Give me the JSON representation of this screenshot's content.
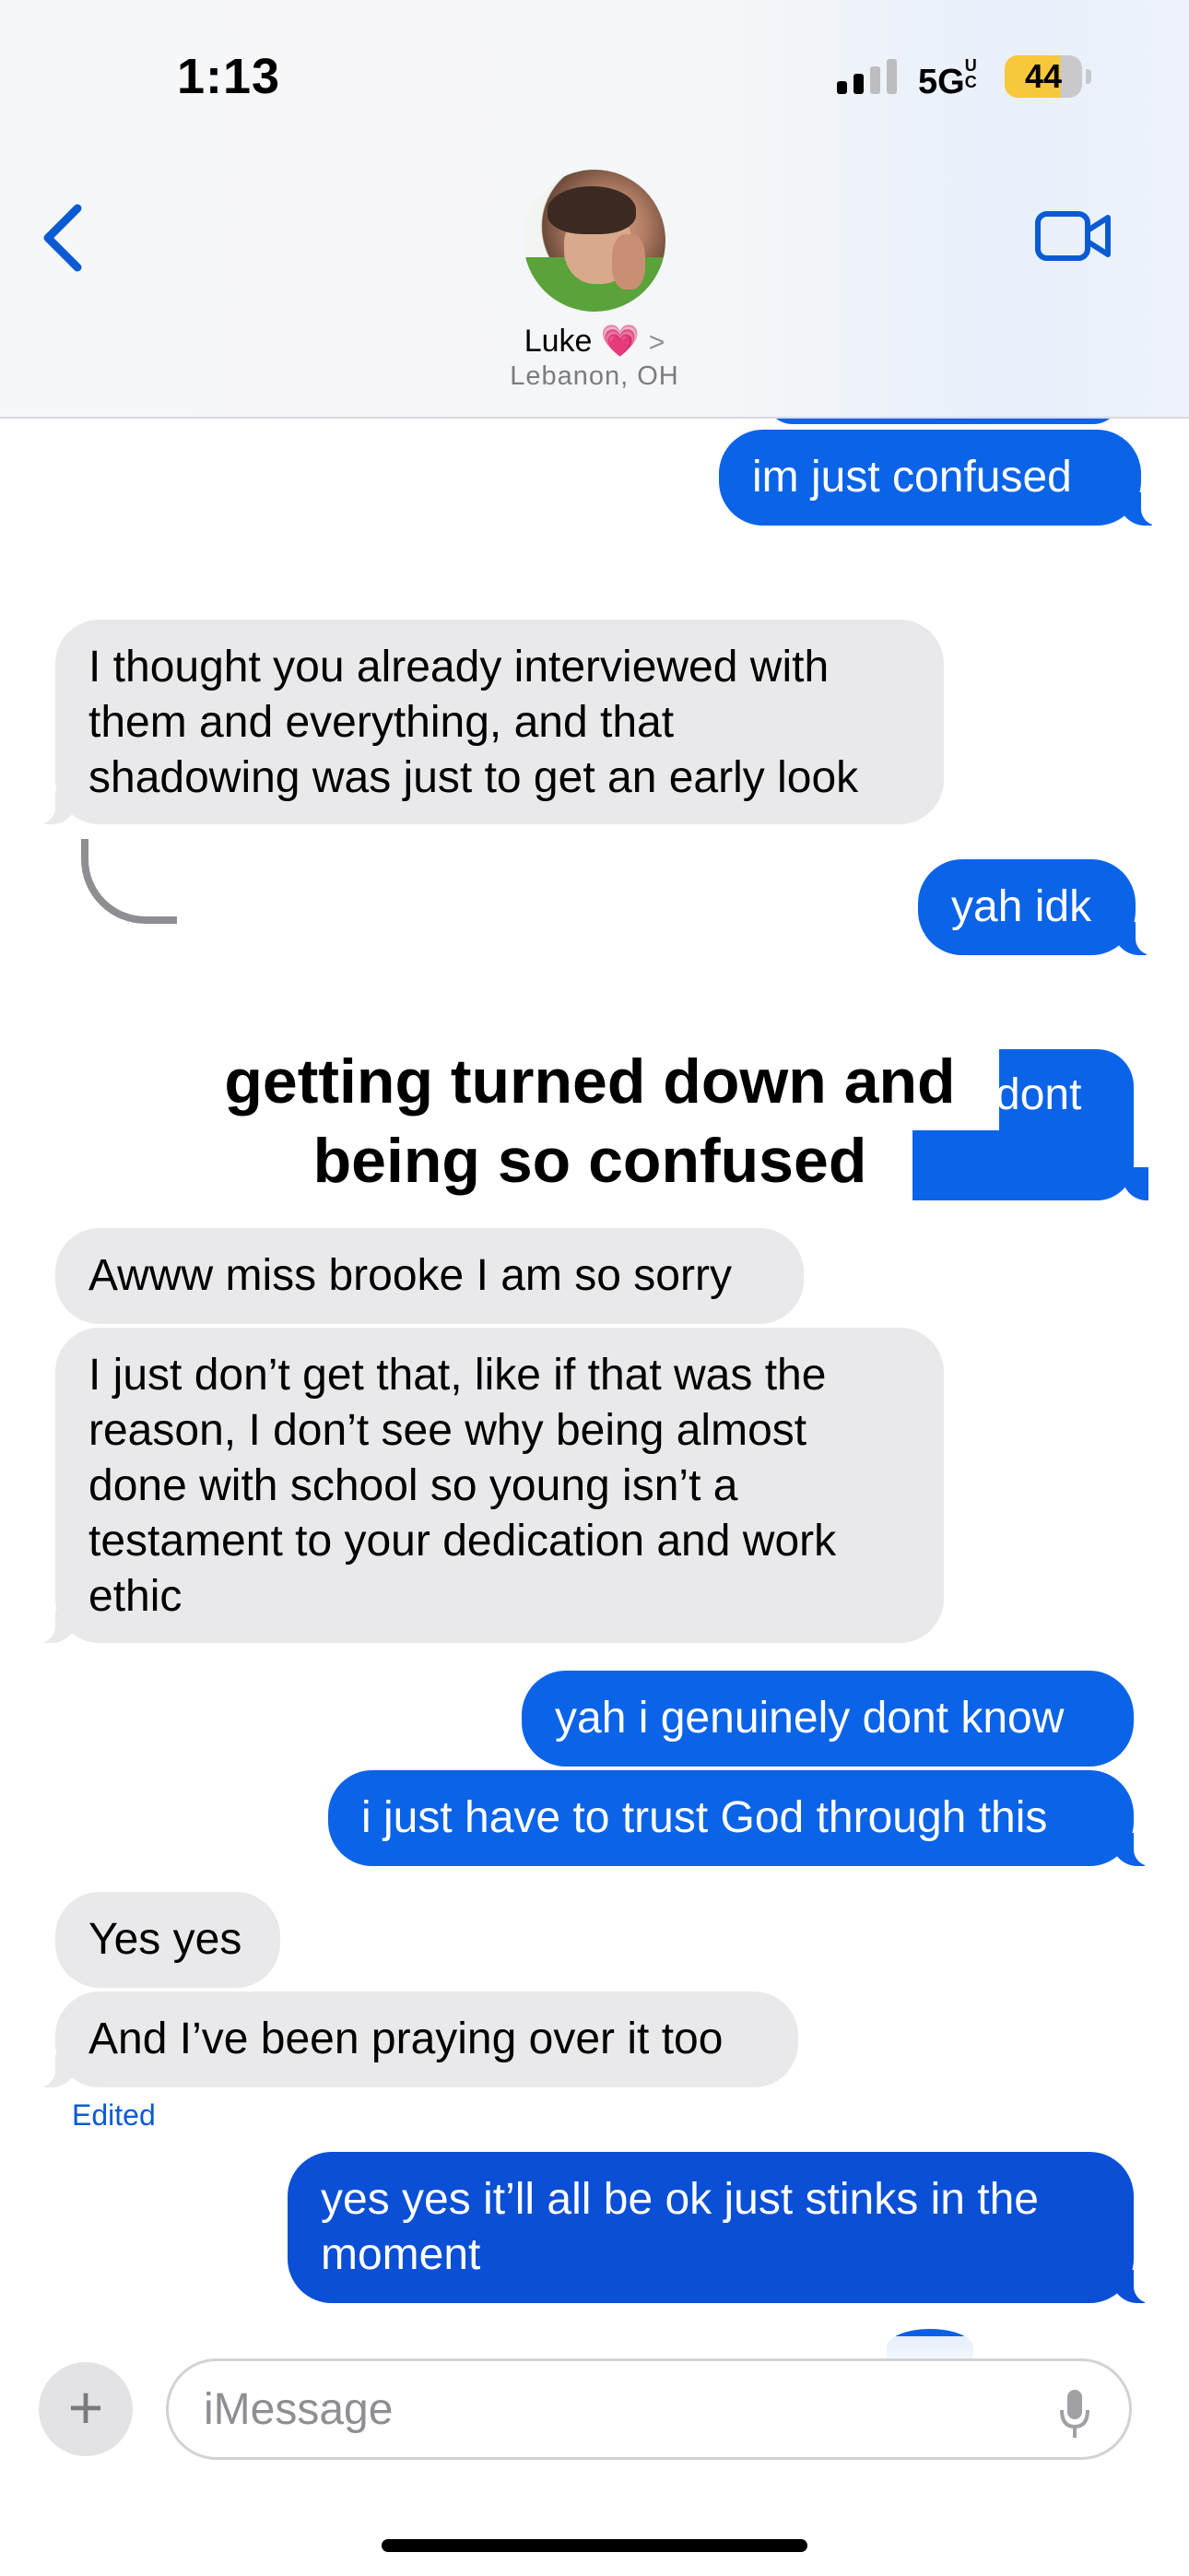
{
  "status_bar": {
    "time": "1:13",
    "network": "5G",
    "network_suffix": "UC",
    "battery": "44"
  },
  "header": {
    "back_icon": "chevron-left-icon",
    "video_icon": "video-camera-icon",
    "contact_name": "Luke",
    "contact_emoji": "💗",
    "contact_chevron": ">",
    "contact_location": "Lebanon, OH"
  },
  "messages": [
    {
      "dir": "out",
      "lines": [
        "im just confused"
      ]
    },
    {
      "dir": "in",
      "lines": [
        "I thought you already interviewed with",
        "them and everything, and that",
        "shadowing was just to get an early look"
      ]
    },
    {
      "dir": "out",
      "lines": [
        "yah idk"
      ]
    },
    {
      "dir": "out-effect",
      "lines": [
        "dont"
      ]
    },
    {
      "dir": "in",
      "lines": [
        "Awww miss brooke I am so sorry"
      ]
    },
    {
      "dir": "in",
      "lines": [
        "I just don’t get that, like if that was the",
        "reason, I don’t see why being almost",
        "done with school so young isn’t a",
        "testament to your dedication and work",
        "ethic"
      ]
    },
    {
      "dir": "out",
      "lines": [
        "yah i genuinely dont know"
      ]
    },
    {
      "dir": "out",
      "lines": [
        "i just have to trust God through this"
      ]
    },
    {
      "dir": "in",
      "lines": [
        "Yes yes"
      ]
    },
    {
      "dir": "in",
      "lines": [
        "And I’ve been praying over it too"
      ]
    },
    {
      "dir": "out",
      "lines": [
        "yes yes it’ll all be ok just stinks in the",
        "moment"
      ]
    }
  ],
  "effect_text": "getting turned down and being so confused",
  "edited_label": "Edited",
  "input": {
    "placeholder": "iMessage",
    "plus_icon": "plus-icon",
    "mic_icon": "microphone-icon"
  },
  "colors": {
    "outgoing": "#0b63e8",
    "incoming": "#e9e9eb",
    "accent": "#0a5bd3",
    "heart": "#ff2fa6"
  }
}
